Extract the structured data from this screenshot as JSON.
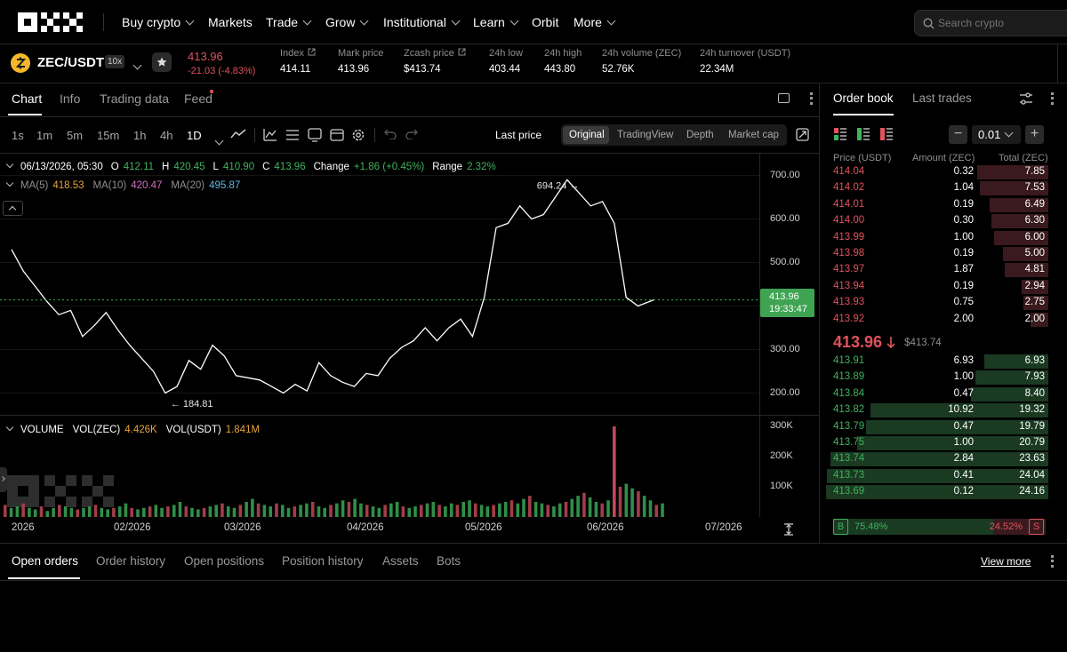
{
  "nav": {
    "items": [
      {
        "label": "Buy crypto",
        "chevron": true
      },
      {
        "label": "Markets",
        "chevron": false
      },
      {
        "label": "Trade",
        "chevron": true
      },
      {
        "label": "Grow",
        "chevron": true
      },
      {
        "label": "Institutional",
        "chevron": true
      },
      {
        "label": "Learn",
        "chevron": true
      },
      {
        "label": "Orbit",
        "chevron": false
      },
      {
        "label": "More",
        "chevron": true
      }
    ],
    "search_placeholder": "Search crypto"
  },
  "ticker": {
    "pair": "ZEC/USDT",
    "leverage": "10x",
    "last_price": "413.96",
    "change": "-21.03 (-4.83%)",
    "stats": [
      {
        "label": "Index",
        "value": "414.11"
      },
      {
        "label": "Mark price",
        "value": "413.96"
      },
      {
        "label": "Zcash price",
        "value": "$413.74"
      },
      {
        "label": "24h low",
        "value": "403.44"
      },
      {
        "label": "24h high",
        "value": "443.80"
      },
      {
        "label": "24h volume (ZEC)",
        "value": "52.76K"
      },
      {
        "label": "24h turnover (USDT)",
        "value": "22.34M"
      }
    ]
  },
  "chart_tabs": [
    "Chart",
    "Info",
    "Trading data",
    "Feed"
  ],
  "intervals": [
    "1s",
    "1m",
    "5m",
    "15m",
    "1h",
    "4h",
    "1D"
  ],
  "price_source": "Last price",
  "view_modes": [
    "Original",
    "TradingView",
    "Depth",
    "Market cap"
  ],
  "ohlc": {
    "date": "06/13/2026, 05:30",
    "o_label": "O",
    "o": "412.11",
    "h_label": "H",
    "h": "420.45",
    "l_label": "L",
    "l": "410.90",
    "c_label": "C",
    "c": "413.96",
    "change_label": "Change",
    "change": "+1.86 (+0.45%)",
    "range_label": "Range",
    "range": "2.32%"
  },
  "ma": {
    "ma5_label": "MA(5)",
    "ma5": "418.53",
    "ma10_label": "MA(10)",
    "ma10": "420.47",
    "ma20_label": "MA(20)",
    "ma20": "495.87"
  },
  "volume": {
    "label": "VOLUME",
    "zec_label": "VOL(ZEC)",
    "zec": "4.426K",
    "usdt_label": "VOL(USDT)",
    "usdt": "1.841M"
  },
  "chart_data": {
    "type": "line",
    "x": [
      "2026-01-01",
      "2026-01-04",
      "2026-01-07",
      "2026-01-10",
      "2026-01-13",
      "2026-01-16",
      "2026-01-19",
      "2026-01-22",
      "2026-01-25",
      "2026-01-28",
      "2026-01-31",
      "2026-02-03",
      "2026-02-06",
      "2026-02-09",
      "2026-02-12",
      "2026-02-15",
      "2026-02-18",
      "2026-02-21",
      "2026-02-24",
      "2026-02-27",
      "2026-03-02",
      "2026-03-05",
      "2026-03-08",
      "2026-03-11",
      "2026-03-14",
      "2026-03-17",
      "2026-03-20",
      "2026-03-23",
      "2026-03-26",
      "2026-03-29",
      "2026-04-01",
      "2026-04-04",
      "2026-04-07",
      "2026-04-10",
      "2026-04-13",
      "2026-04-16",
      "2026-04-19",
      "2026-04-22",
      "2026-04-25",
      "2026-04-28",
      "2026-05-01",
      "2026-05-04",
      "2026-05-07",
      "2026-05-10",
      "2026-05-13",
      "2026-05-16",
      "2026-05-19",
      "2026-05-22",
      "2026-05-25",
      "2026-05-28",
      "2026-05-31",
      "2026-06-03",
      "2026-06-06",
      "2026-06-09",
      "2026-06-13"
    ],
    "series": [
      {
        "values": [
          530,
          480,
          445,
          410,
          380,
          390,
          330,
          355,
          385,
          345,
          310,
          280,
          250,
          200,
          215,
          275,
          255,
          310,
          285,
          240,
          235,
          230,
          215,
          200,
          220,
          205,
          270,
          240,
          225,
          215,
          245,
          240,
          280,
          305,
          320,
          350,
          320,
          350,
          370,
          330,
          420,
          580,
          590,
          630,
          600,
          610,
          650,
          690,
          660,
          630,
          640,
          590,
          420,
          400,
          414
        ]
      },
      {
        "values": [
          540,
          520,
          480,
          440,
          400,
          380,
          350,
          330,
          340,
          330,
          320,
          290,
          265,
          240,
          230,
          235,
          250,
          265,
          270,
          260,
          250,
          235,
          225,
          210,
          210,
          215,
          225,
          230,
          230,
          225,
          230,
          240,
          255,
          275,
          300,
          320,
          330,
          340,
          350,
          355,
          390,
          450,
          520,
          580,
          600,
          615,
          630,
          650,
          660,
          650,
          640,
          625,
          560,
          490,
          419
        ]
      }
    ],
    "ylim": [
      150,
      750
    ],
    "y_ticks": [
      "700.00",
      "600.00",
      "500.00",
      "400.00",
      "300.00",
      "200.00"
    ],
    "x_ticks": [
      "2026",
      "02/2026",
      "03/2026",
      "04/2026",
      "05/2026",
      "06/2026",
      "07/2026"
    ],
    "annotations": {
      "high": "694.24",
      "low": "184.81"
    },
    "current_price": "413.96",
    "countdown": "19:33:47",
    "volume_ticks": [
      "300K",
      "200K",
      "100K"
    ],
    "volume_ylim": [
      0,
      300
    ],
    "volume_values": [
      40,
      30,
      35,
      45,
      30,
      25,
      35,
      20,
      30,
      40,
      35,
      30,
      25,
      30,
      35,
      40,
      30,
      25,
      30,
      35,
      45,
      30,
      25,
      30,
      35,
      40,
      30,
      35,
      40,
      50,
      35,
      30,
      25,
      30,
      35,
      40,
      45,
      35,
      30,
      40,
      50,
      60,
      45,
      40,
      35,
      45,
      40,
      30,
      35,
      40,
      45,
      50,
      35,
      30,
      40,
      45,
      55,
      50,
      60,
      45,
      40,
      35,
      30,
      40,
      45,
      50,
      35,
      30,
      35,
      40,
      45,
      50,
      40,
      35,
      45,
      40,
      50,
      55,
      45,
      40,
      35,
      40,
      45,
      50,
      55,
      45,
      60,
      70,
      50,
      45,
      40,
      35,
      45,
      50,
      60,
      70,
      80,
      65,
      50,
      45,
      55,
      300,
      100,
      110,
      95,
      85,
      70,
      55,
      40,
      45
    ]
  },
  "orderbook": {
    "tabs": [
      "Order book",
      "Last trades"
    ],
    "tick_size": "0.01",
    "headers": [
      "Price (USDT)",
      "Amount (ZEC)",
      "Total (ZEC)"
    ],
    "asks": [
      {
        "price": "414.04",
        "amount": "0.32",
        "total": "7.85"
      },
      {
        "price": "414.02",
        "amount": "1.04",
        "total": "7.53"
      },
      {
        "price": "414.01",
        "amount": "0.19",
        "total": "6.49"
      },
      {
        "price": "414.00",
        "amount": "0.30",
        "total": "6.30"
      },
      {
        "price": "413.99",
        "amount": "1.00",
        "total": "6.00"
      },
      {
        "price": "413.98",
        "amount": "0.19",
        "total": "5.00"
      },
      {
        "price": "413.97",
        "amount": "1.87",
        "total": "4.81"
      },
      {
        "price": "413.94",
        "amount": "0.19",
        "total": "2.94"
      },
      {
        "price": "413.93",
        "amount": "0.75",
        "total": "2.75"
      },
      {
        "price": "413.92",
        "amount": "2.00",
        "total": "2.00"
      }
    ],
    "last_price": "413.96",
    "last_usd": "$413.74",
    "bids": [
      {
        "price": "413.91",
        "amount": "6.93",
        "total": "6.93"
      },
      {
        "price": "413.89",
        "amount": "1.00",
        "total": "7.93"
      },
      {
        "price": "413.84",
        "amount": "0.47",
        "total": "8.40"
      },
      {
        "price": "413.82",
        "amount": "10.92",
        "total": "19.32"
      },
      {
        "price": "413.79",
        "amount": "0.47",
        "total": "19.79"
      },
      {
        "price": "413.75",
        "amount": "1.00",
        "total": "20.79"
      },
      {
        "price": "413.74",
        "amount": "2.84",
        "total": "23.63"
      },
      {
        "price": "413.73",
        "amount": "0.41",
        "total": "24.04"
      },
      {
        "price": "413.69",
        "amount": "0.12",
        "total": "24.16"
      }
    ],
    "buy_label": "B",
    "buy_pct": "75.48%",
    "sell_pct": "24.52%",
    "sell_label": "S",
    "buy_ratio": 0.7548
  },
  "bottom_tabs": [
    "Open orders",
    "Order history",
    "Open positions",
    "Position history",
    "Assets",
    "Bots"
  ],
  "view_more": "View more",
  "colors": {
    "up": "#3fb35d",
    "down": "#e0525c",
    "accent_bg": "#1b1b1b"
  }
}
